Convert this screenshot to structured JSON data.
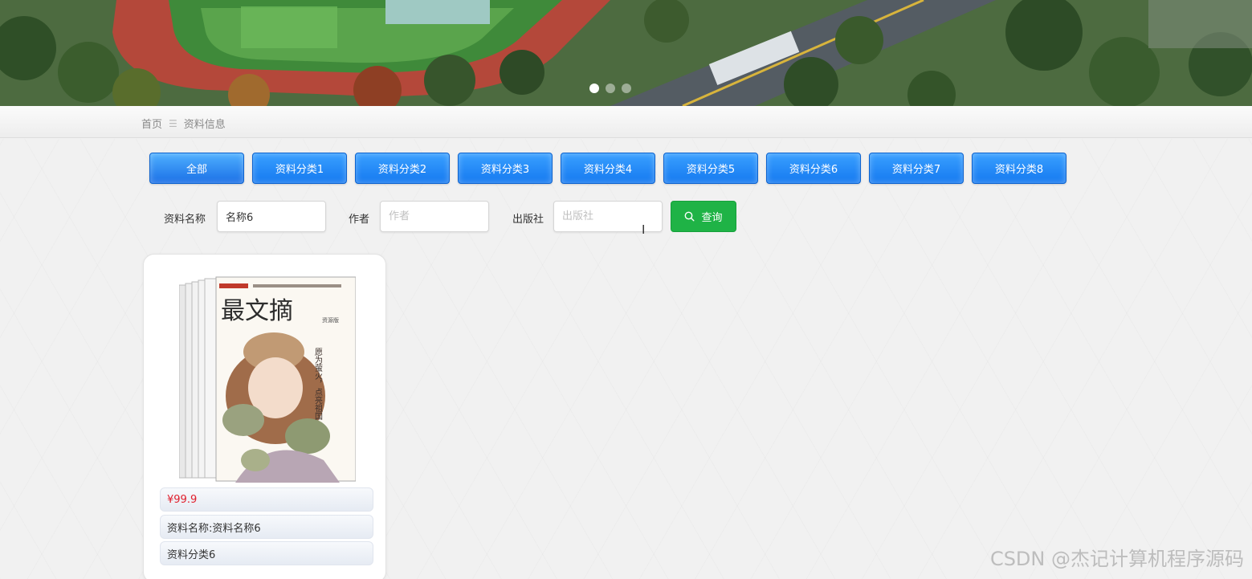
{
  "banner": {
    "slides": [
      {
        "label": "slide 1"
      },
      {
        "label": "slide 2"
      },
      {
        "label": "slide 3"
      }
    ],
    "active_slide": 1
  },
  "breadcrumb": {
    "home": "首页",
    "separator": "☰",
    "current": "资料信息"
  },
  "categories": [
    {
      "label": "全部",
      "active": true
    },
    {
      "label": "资料分类1"
    },
    {
      "label": "资料分类2"
    },
    {
      "label": "资料分类3"
    },
    {
      "label": "资料分类4"
    },
    {
      "label": "资料分类5"
    },
    {
      "label": "资料分类6"
    },
    {
      "label": "资料分类7"
    },
    {
      "label": "资料分类8"
    }
  ],
  "search": {
    "name_label": "资料名称",
    "name_value": "名称6",
    "author_label": "作者",
    "author_placeholder": "作者",
    "publisher_label": "出版社",
    "publisher_placeholder": "出版社",
    "query_label": "查询"
  },
  "results": [
    {
      "price": "¥99.9",
      "name": "资料名称:资料名称6",
      "category": "资料分类6",
      "cover": {
        "title": "最文摘",
        "tagline": "愿为萤火，点亮祖国",
        "edition": "资源版"
      }
    }
  ],
  "watermark": "CSDN @杰记计算机程序源码",
  "colors": {
    "tab_blue": "#1579f0",
    "search_green": "#1fb346",
    "price_red": "#e01e2b"
  }
}
